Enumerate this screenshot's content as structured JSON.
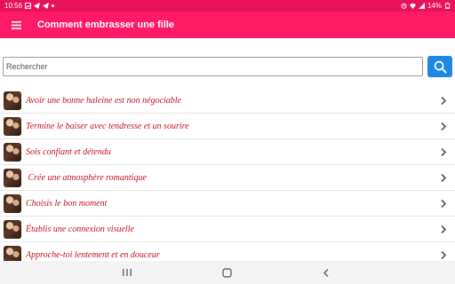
{
  "status": {
    "time": "10:56",
    "battery": "14%"
  },
  "appbar": {
    "title": "Comment embrasser une fille"
  },
  "search": {
    "placeholder": "Rechercher",
    "value": ""
  },
  "list": [
    {
      "label": "Avoir une bonne haleine est non négociable"
    },
    {
      "label": "Termine le baiser avec tendresse et un sourire"
    },
    {
      "label": "Sois confiant et détendu"
    },
    {
      "label": " Crée une atmosphère romantique"
    },
    {
      "label": "Choisis le bon moment"
    },
    {
      "label": "Établis une connexion visuelle"
    },
    {
      "label": "Approche-toi lentement et en douceur"
    }
  ],
  "colors": {
    "statusbar": "#e8115b",
    "appbar": "#ff1a66",
    "item_text": "#c1121f",
    "search_button": "#1e88e5"
  }
}
